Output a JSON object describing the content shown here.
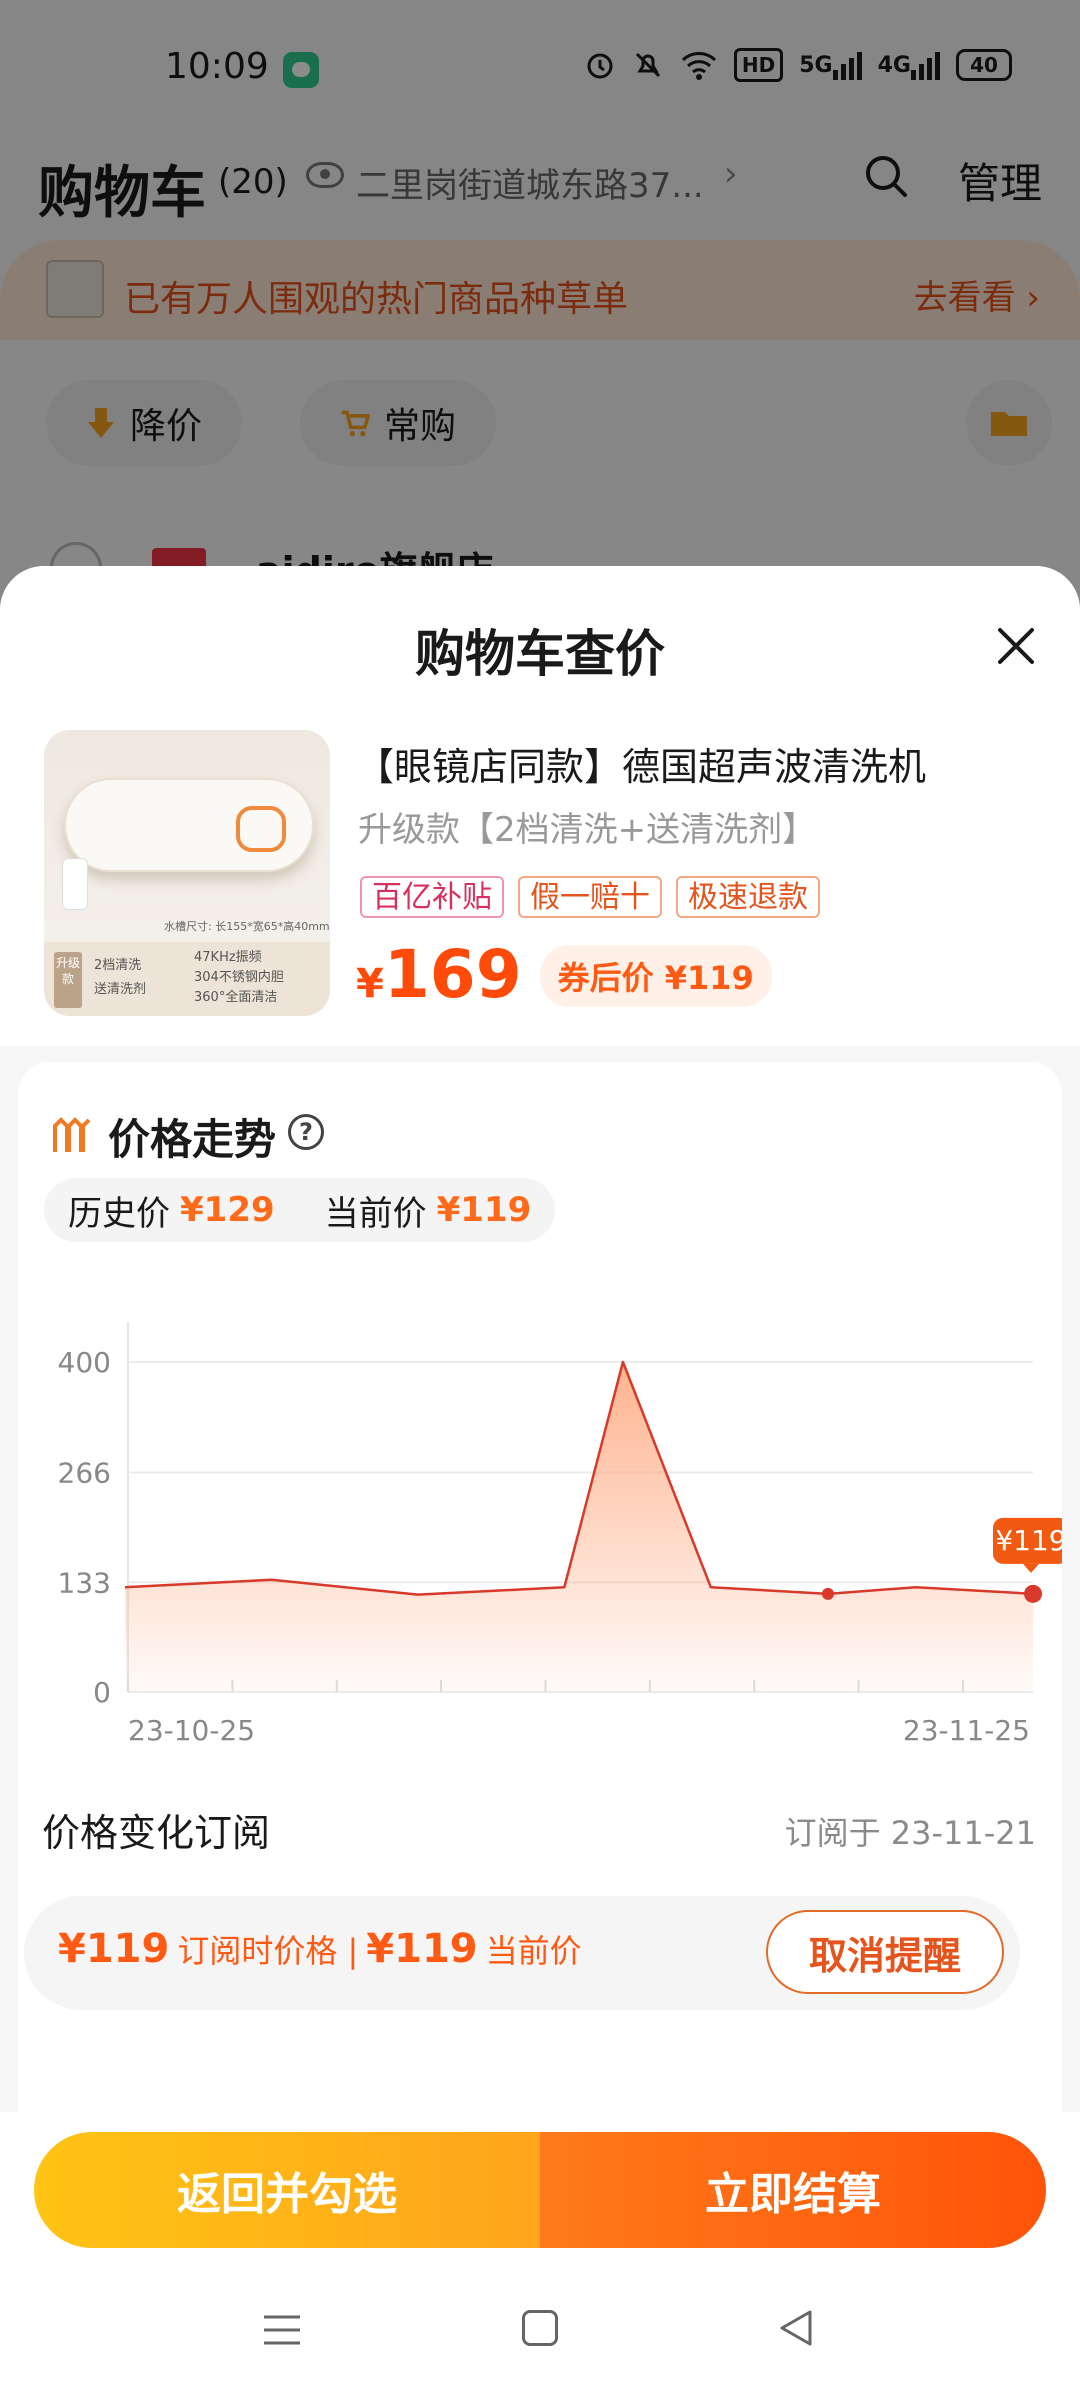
{
  "status_bar": {
    "time": "10:09",
    "hd_label": "HD",
    "signal1": "5G",
    "signal2": "4G",
    "battery": "40"
  },
  "cart": {
    "title": "购物车",
    "count": "(20)",
    "address": "二里岗街道城东路37...",
    "manage": "管理",
    "promo_text": "已有万人围观的热门商品种草单",
    "promo_link": "去看看",
    "filters": [
      {
        "label": "降价",
        "icon": "down-arrow-icon"
      },
      {
        "label": "常购",
        "icon": "cart-icon"
      }
    ],
    "shop_name": "aidiro旗舰店"
  },
  "sheet": {
    "title": "购物车查价",
    "product": {
      "title": "【眼镜店同款】德国超声波清洗机",
      "sku": "升级款【2档清洗+送清洗剂】",
      "tags": [
        "百亿补贴",
        "假一赔十",
        "极速退款"
      ],
      "price_symbol": "¥",
      "price": "169",
      "coupon_price": "券后价 ¥119",
      "image_texts": {
        "dims": "水槽尺寸: 长155*宽65*高40mm",
        "badge": "升级款",
        "features": [
          "2档清洗",
          "送清洗剂",
          "47KHz振频",
          "304不锈钢内胆",
          "360°全面清洁"
        ]
      }
    },
    "trend": {
      "title": "价格走势",
      "help": "?",
      "history_label": "历史价",
      "history_value": "¥129",
      "current_label": "当前价",
      "current_value": "¥119"
    },
    "subscription": {
      "title": "价格变化订阅",
      "date": "订阅于 23-11-21",
      "sub_price": "¥119",
      "sub_label": "订阅时价格 |",
      "cur_price": "¥119",
      "cur_label": "当前价",
      "cancel": "取消提醒"
    }
  },
  "chart_data": {
    "type": "area",
    "y_ticks": [
      0,
      133,
      266,
      400
    ],
    "ylim": [
      0,
      400
    ],
    "x_labels": [
      "23-10-25",
      "23-11-25"
    ],
    "x_range": [
      "23-10-25",
      "23-11-25"
    ],
    "grid": true,
    "points": [
      {
        "x": "23-10-25",
        "y": 127
      },
      {
        "x": "23-10-30",
        "y": 136
      },
      {
        "x": "23-11-04",
        "y": 118
      },
      {
        "x": "23-11-09",
        "y": 127
      },
      {
        "x": "23-11-11",
        "y": 400
      },
      {
        "x": "23-11-14",
        "y": 127
      },
      {
        "x": "23-11-18",
        "y": 119
      },
      {
        "x": "23-11-21",
        "y": 127
      },
      {
        "x": "23-11-25",
        "y": 119
      }
    ],
    "highlight_label": "¥119",
    "colors": {
      "line": "#d9392b",
      "fill": "#ff9a6a"
    }
  },
  "footer": {
    "back_select": "返回并勾选",
    "checkout": "立即结算"
  }
}
